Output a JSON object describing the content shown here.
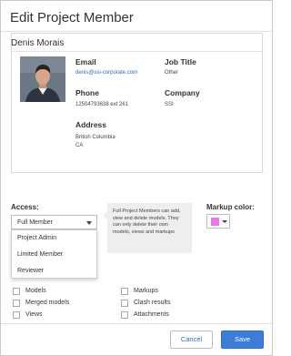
{
  "dialog": {
    "title": "Edit Project Member"
  },
  "member": {
    "name": "Denis Morais",
    "email_label": "Email",
    "email": "denis@ssi-corporate.com",
    "job_title_label": "Job Title",
    "job_title": "Other",
    "phone_label": "Phone",
    "phone": "12504793638 ext 261",
    "company_label": "Company",
    "company": "SSI",
    "address_label": "Address",
    "address_line1": "British Columbia",
    "address_line2": "CA"
  },
  "access": {
    "label": "Access:",
    "selected": "Full Member",
    "options": [
      "Project Admin",
      "Limited Member",
      "Reviewer"
    ],
    "info": "Full Project Members can add, view and delete models. They can only delete their own models, views and markups"
  },
  "markup": {
    "label": "Markup color:",
    "color": "#e87ae8"
  },
  "permissions": [
    {
      "label": "Models"
    },
    {
      "label": "Merged models"
    },
    {
      "label": "Views"
    },
    {
      "label": "Markups"
    },
    {
      "label": "Clash results"
    },
    {
      "label": "Attachments"
    }
  ],
  "buttons": {
    "cancel": "Cancel",
    "save": "Save"
  },
  "icons": {
    "caret": "chevron-down-icon",
    "checkbox": "checkbox-icon"
  }
}
